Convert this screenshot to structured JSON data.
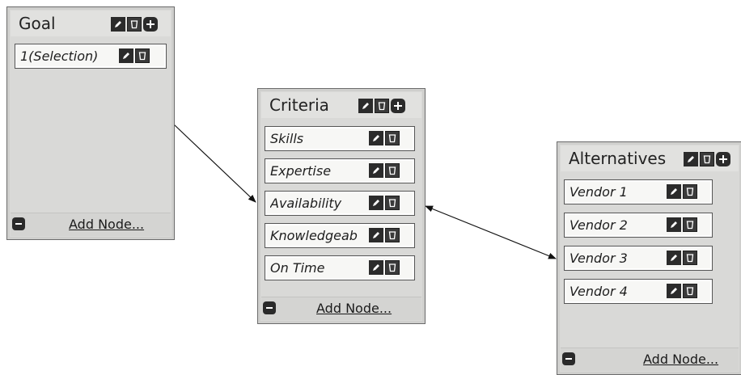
{
  "goal": {
    "title": "Goal",
    "nodes": [
      {
        "label": "1(Selection)"
      }
    ],
    "add_node_label": "Add Node..."
  },
  "criteria": {
    "title": "Criteria",
    "nodes": [
      {
        "label": "Skills"
      },
      {
        "label": "Expertise"
      },
      {
        "label": "Availability"
      },
      {
        "label": "Knowledgeab"
      },
      {
        "label": "On Time"
      }
    ],
    "add_node_label": "Add Node..."
  },
  "alternatives": {
    "title": "Alternatives",
    "nodes": [
      {
        "label": "Vendor 1"
      },
      {
        "label": "Vendor 2"
      },
      {
        "label": "Vendor 3"
      },
      {
        "label": "Vendor 4"
      }
    ],
    "add_node_label": "Add Node..."
  },
  "icons": {
    "edit": "pencil-icon",
    "delete": "trash-icon",
    "add": "plus-icon",
    "collapse": "minus-icon"
  },
  "colors": {
    "panel_bg": "#d9d9d7",
    "panel_border": "#6b6b6b",
    "button_dark": "#2b2b2b",
    "node_bg": "#f7f7f5"
  }
}
